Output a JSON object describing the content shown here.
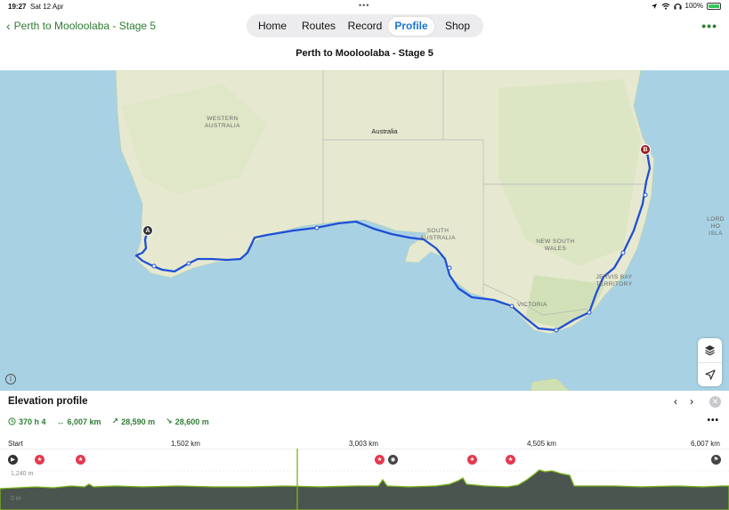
{
  "status_bar": {
    "time": "19:27",
    "date": "Sat 12 Apr",
    "battery": "100%"
  },
  "nav": {
    "back_label": "Perth to Mooloolaba - Stage 5",
    "tabs": [
      {
        "label": "Home",
        "active": false
      },
      {
        "label": "Routes",
        "active": false
      },
      {
        "label": "Record",
        "active": false
      },
      {
        "label": "Profile",
        "active": true
      },
      {
        "label": "Shop",
        "active": false
      }
    ]
  },
  "route_title": "Perth to Mooloolaba - Stage 5",
  "map": {
    "labels": {
      "western_australia": "WESTERN AUSTRALIA",
      "australia": "Australia",
      "south_australia": "SOUTH AUSTRALIA",
      "new_south_wales": "NEW SOUTH WALES",
      "victoria": "VICTORIA",
      "jervis_bay": "JERVIS BAY TERRITORY",
      "lord_howe": "LORD HO ISLA"
    },
    "start_pin": "A",
    "end_pin": "B",
    "route_color": "#1f4fd6"
  },
  "elevation": {
    "title": "Elevation profile",
    "stats": {
      "duration": "370 h 4",
      "distance": "6,007 km",
      "ascent": "28,590 m",
      "descent": "28,600 m"
    },
    "axis": [
      "Start",
      "1,502 km",
      "3,003 km",
      "4,505 km",
      "6,007 km"
    ],
    "elev_max_label": "1,240 m",
    "elev_min_label": "0 m",
    "accent": "#7cb518"
  }
}
